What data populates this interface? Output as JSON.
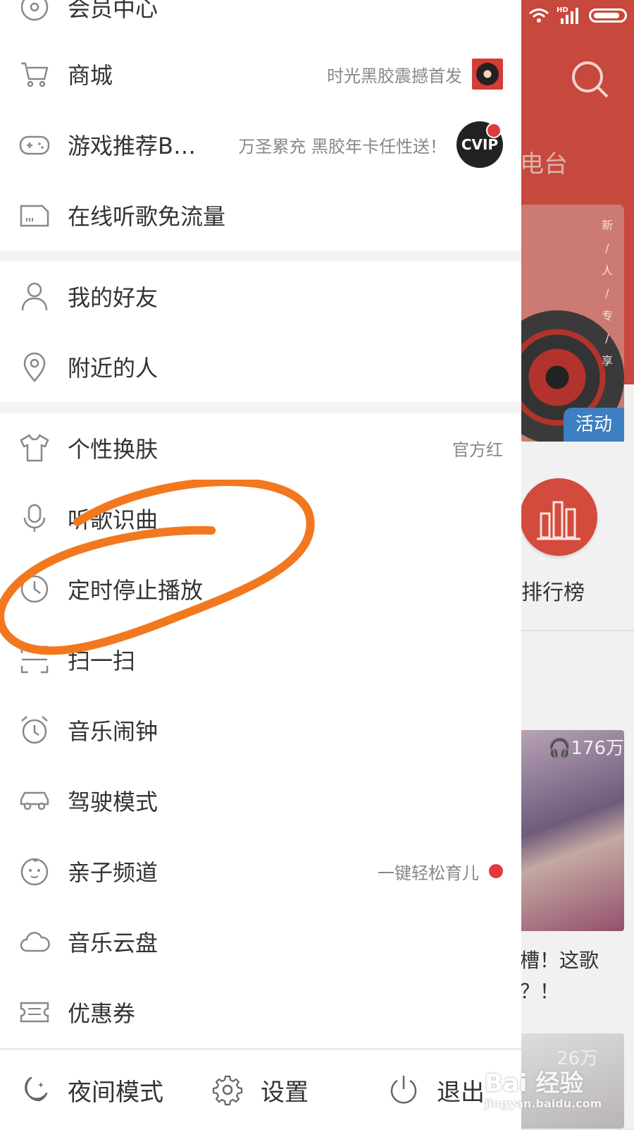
{
  "background": {
    "tab_text": "电台",
    "banner_vertical_text": [
      "新",
      "/",
      "人",
      "/",
      "专",
      "/",
      "享"
    ],
    "banner_tag": "活动",
    "rank_label": "排行榜",
    "album1_play_count": "176万",
    "album1_title_lines": [
      "槽！这歌",
      "？！"
    ],
    "album2_play_count": "26万"
  },
  "menu": {
    "member_center": "会员中心",
    "mall": {
      "label": "商城",
      "extra": "时光黑胶震撼首发"
    },
    "game": {
      "label": "游戏推荐B…",
      "extra": "万圣累充 黑胶年卡任性送！",
      "badge": "CVIP"
    },
    "free_flow": "在线听歌免流量",
    "friends": "我的好友",
    "nearby": "附近的人",
    "skin": {
      "label": "个性换肤",
      "extra": "官方红"
    },
    "recognize": "听歌识曲",
    "timer_stop": "定时停止播放",
    "scan": "扫一扫",
    "alarm": "音乐闹钟",
    "driving": "驾驶模式",
    "kids": {
      "label": "亲子频道",
      "extra": "一键轻松育儿"
    },
    "cloud": "音乐云盘",
    "coupon": "优惠券"
  },
  "bottom": {
    "night_mode": "夜间模式",
    "settings": "设置",
    "exit": "退出"
  },
  "status_bar": {
    "hd": "HD"
  },
  "watermark": {
    "main": "Bai 经验",
    "url": "jingyan.baidu.com"
  },
  "colors": {
    "brand_red": "#c7483c",
    "annotation_orange": "#f2781f",
    "badge_red": "#e0393e"
  }
}
